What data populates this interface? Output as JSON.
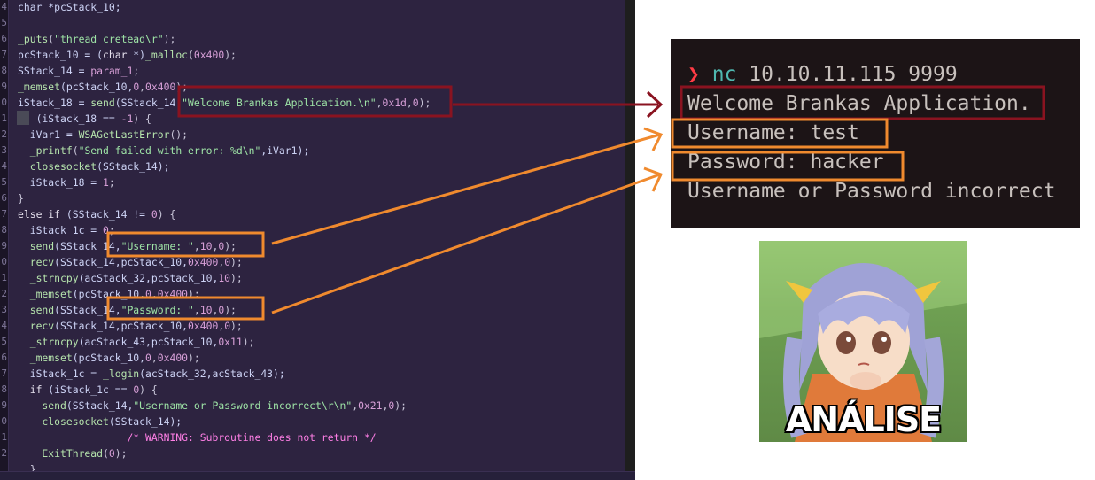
{
  "code": {
    "gutter_numbers": [
      "4",
      "5",
      "6",
      "7",
      "8",
      "9",
      "0",
      "1",
      "2",
      "3",
      "4",
      "5",
      "6",
      "7",
      "8",
      "9",
      "0",
      "1",
      "2",
      "3",
      "4",
      "5",
      "6",
      "7",
      "8",
      "9",
      "0",
      "1",
      "2"
    ],
    "lines": [
      [
        {
          "t": "char *pcStack_10;",
          "c": "id"
        }
      ],
      [],
      [
        {
          "t": "_puts",
          "c": "fn"
        },
        {
          "t": "(",
          "c": "pn"
        },
        {
          "t": "\"thread cretead\\r\"",
          "c": "str"
        },
        {
          "t": ");",
          "c": "pn"
        }
      ],
      [
        {
          "t": "pcStack_10 = (",
          "c": "id"
        },
        {
          "t": "char",
          "c": "kw"
        },
        {
          "t": " *)",
          "c": "id"
        },
        {
          "t": "_malloc",
          "c": "fn"
        },
        {
          "t": "(",
          "c": "pn"
        },
        {
          "t": "0x400",
          "c": "num"
        },
        {
          "t": ");",
          "c": "pn"
        }
      ],
      [
        {
          "t": "SStack_14 = ",
          "c": "id"
        },
        {
          "t": "param_1",
          "c": "num"
        },
        {
          "t": ";",
          "c": "pn"
        }
      ],
      [
        {
          "t": "_memset",
          "c": "fn"
        },
        {
          "t": "(pcStack_10,",
          "c": "id"
        },
        {
          "t": "0",
          "c": "num"
        },
        {
          "t": ",",
          "c": "pn"
        },
        {
          "t": "0x400",
          "c": "num"
        },
        {
          "t": ");",
          "c": "pn"
        }
      ],
      [
        {
          "t": "iStack_18 = ",
          "c": "id"
        },
        {
          "t": "send",
          "c": "fn"
        },
        {
          "t": "(SStack_14,",
          "c": "id"
        },
        {
          "t": "\"Welcome Brankas Application.\\n\"",
          "c": "str"
        },
        {
          "t": ",",
          "c": "pn"
        },
        {
          "t": "0x1d",
          "c": "num"
        },
        {
          "t": ",",
          "c": "pn"
        },
        {
          "t": "0",
          "c": "num"
        },
        {
          "t": ");",
          "c": "pn"
        }
      ],
      [
        {
          "t": "if",
          "c": "kw"
        },
        {
          "t": " (iStack_18 == ",
          "c": "id"
        },
        {
          "t": "-1",
          "c": "num"
        },
        {
          "t": ") {",
          "c": "pn"
        }
      ],
      [
        {
          "t": "  iVar1 = ",
          "c": "id"
        },
        {
          "t": "WSAGetLastError",
          "c": "fn"
        },
        {
          "t": "();",
          "c": "pn"
        }
      ],
      [
        {
          "t": "  _printf",
          "c": "fn"
        },
        {
          "t": "(",
          "c": "pn"
        },
        {
          "t": "\"Send failed with error: %d\\n\"",
          "c": "str"
        },
        {
          "t": ",iVar1);",
          "c": "id"
        }
      ],
      [
        {
          "t": "  closesocket",
          "c": "fn"
        },
        {
          "t": "(SStack_14);",
          "c": "id"
        }
      ],
      [
        {
          "t": "  iStack_18 = ",
          "c": "id"
        },
        {
          "t": "1",
          "c": "num"
        },
        {
          "t": ";",
          "c": "pn"
        }
      ],
      [
        {
          "t": "}",
          "c": "pn"
        }
      ],
      [
        {
          "t": "else if",
          "c": "kw"
        },
        {
          "t": " (SStack_14 != ",
          "c": "id"
        },
        {
          "t": "0",
          "c": "num"
        },
        {
          "t": ") {",
          "c": "pn"
        }
      ],
      [
        {
          "t": "  iStack_1c = ",
          "c": "id"
        },
        {
          "t": "0",
          "c": "num"
        },
        {
          "t": ";",
          "c": "pn"
        }
      ],
      [
        {
          "t": "  send",
          "c": "fn"
        },
        {
          "t": "(SStack_14,",
          "c": "id"
        },
        {
          "t": "\"Username: \"",
          "c": "str"
        },
        {
          "t": ",",
          "c": "pn"
        },
        {
          "t": "10",
          "c": "num"
        },
        {
          "t": ",",
          "c": "pn"
        },
        {
          "t": "0",
          "c": "num"
        },
        {
          "t": ");",
          "c": "pn"
        }
      ],
      [
        {
          "t": "  recv",
          "c": "fn"
        },
        {
          "t": "(SStack_14,pcStack_10,",
          "c": "id"
        },
        {
          "t": "0x400",
          "c": "num"
        },
        {
          "t": ",",
          "c": "pn"
        },
        {
          "t": "0",
          "c": "num"
        },
        {
          "t": ");",
          "c": "pn"
        }
      ],
      [
        {
          "t": "  _strncpy",
          "c": "fn"
        },
        {
          "t": "(acStack_32,pcStack_10,",
          "c": "id"
        },
        {
          "t": "10",
          "c": "num"
        },
        {
          "t": ");",
          "c": "pn"
        }
      ],
      [
        {
          "t": "  _memset",
          "c": "fn"
        },
        {
          "t": "(pcStack_10,",
          "c": "id"
        },
        {
          "t": "0",
          "c": "num"
        },
        {
          "t": ",",
          "c": "pn"
        },
        {
          "t": "0x400",
          "c": "num"
        },
        {
          "t": ");",
          "c": "pn"
        }
      ],
      [
        {
          "t": "  send",
          "c": "fn"
        },
        {
          "t": "(SStack_14,",
          "c": "id"
        },
        {
          "t": "\"Password: \"",
          "c": "str"
        },
        {
          "t": ",",
          "c": "pn"
        },
        {
          "t": "10",
          "c": "num"
        },
        {
          "t": ",",
          "c": "pn"
        },
        {
          "t": "0",
          "c": "num"
        },
        {
          "t": ");",
          "c": "pn"
        }
      ],
      [
        {
          "t": "  recv",
          "c": "fn"
        },
        {
          "t": "(SStack_14,pcStack_10,",
          "c": "id"
        },
        {
          "t": "0x400",
          "c": "num"
        },
        {
          "t": ",",
          "c": "pn"
        },
        {
          "t": "0",
          "c": "num"
        },
        {
          "t": ");",
          "c": "pn"
        }
      ],
      [
        {
          "t": "  _strncpy",
          "c": "fn"
        },
        {
          "t": "(acStack_43,pcStack_10,",
          "c": "id"
        },
        {
          "t": "0x11",
          "c": "num"
        },
        {
          "t": ");",
          "c": "pn"
        }
      ],
      [
        {
          "t": "  _memset",
          "c": "fn"
        },
        {
          "t": "(pcStack_10,",
          "c": "id"
        },
        {
          "t": "0",
          "c": "num"
        },
        {
          "t": ",",
          "c": "pn"
        },
        {
          "t": "0x400",
          "c": "num"
        },
        {
          "t": ");",
          "c": "pn"
        }
      ],
      [
        {
          "t": "  iStack_1c = ",
          "c": "id"
        },
        {
          "t": "_login",
          "c": "fn"
        },
        {
          "t": "(acStack_32,acStack_43);",
          "c": "id"
        }
      ],
      [
        {
          "t": "  if",
          "c": "kw"
        },
        {
          "t": " (iStack_1c == ",
          "c": "id"
        },
        {
          "t": "0",
          "c": "num"
        },
        {
          "t": ") {",
          "c": "pn"
        }
      ],
      [
        {
          "t": "    send",
          "c": "fn"
        },
        {
          "t": "(SStack_14,",
          "c": "id"
        },
        {
          "t": "\"Username or Password incorrect\\r\\n\"",
          "c": "str"
        },
        {
          "t": ",",
          "c": "pn"
        },
        {
          "t": "0x21",
          "c": "num"
        },
        {
          "t": ",",
          "c": "pn"
        },
        {
          "t": "0",
          "c": "num"
        },
        {
          "t": ");",
          "c": "pn"
        }
      ],
      [
        {
          "t": "    closesocket",
          "c": "fn"
        },
        {
          "t": "(SStack_14);",
          "c": "id"
        }
      ],
      [
        {
          "t": "                  /* WARNING: Subroutine does not return */",
          "c": "cmt"
        }
      ],
      [
        {
          "t": "    ExitThread",
          "c": "fn"
        },
        {
          "t": "(",
          "c": "pn"
        },
        {
          "t": "0",
          "c": "num"
        },
        {
          "t": ");",
          "c": "pn"
        }
      ],
      [
        {
          "t": "  }",
          "c": "pn"
        }
      ]
    ]
  },
  "terminal": {
    "prompt_symbol": "❯",
    "command_name": "nc",
    "command_args": "10.10.11.115 9999",
    "line_welcome": "Welcome Brankas Application.",
    "line_username": "Username: test",
    "line_password": "Password: hacker",
    "line_result": "Username or Password incorrect"
  },
  "meme": {
    "caption": "ANÁLISE"
  },
  "colors": {
    "highlight_dark_red": "#8a1320",
    "highlight_orange": "#f08a2e",
    "code_bg": "#2d2340",
    "terminal_bg": "#1c1416"
  }
}
